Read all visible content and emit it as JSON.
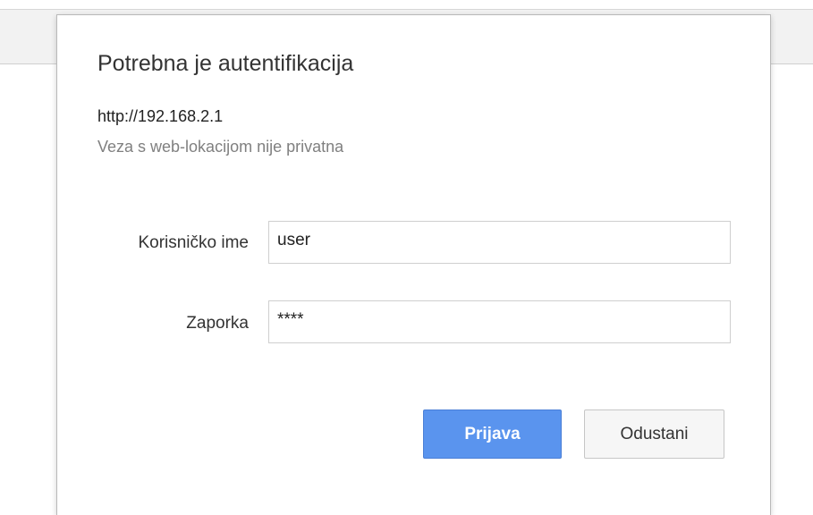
{
  "dialog": {
    "title": "Potrebna je autentifikacija",
    "url": "http://192.168.2.1",
    "warning": "Veza s web-lokacijom nije privatna"
  },
  "form": {
    "username_label": "Korisničko ime",
    "username_value": "user",
    "password_label": "Zaporka",
    "password_value": "****"
  },
  "buttons": {
    "login_label": "Prijava",
    "cancel_label": "Odustani"
  },
  "colors": {
    "primary_button": "#5a94ee",
    "secondary_button": "#f6f6f6",
    "warning_text": "#808080"
  }
}
